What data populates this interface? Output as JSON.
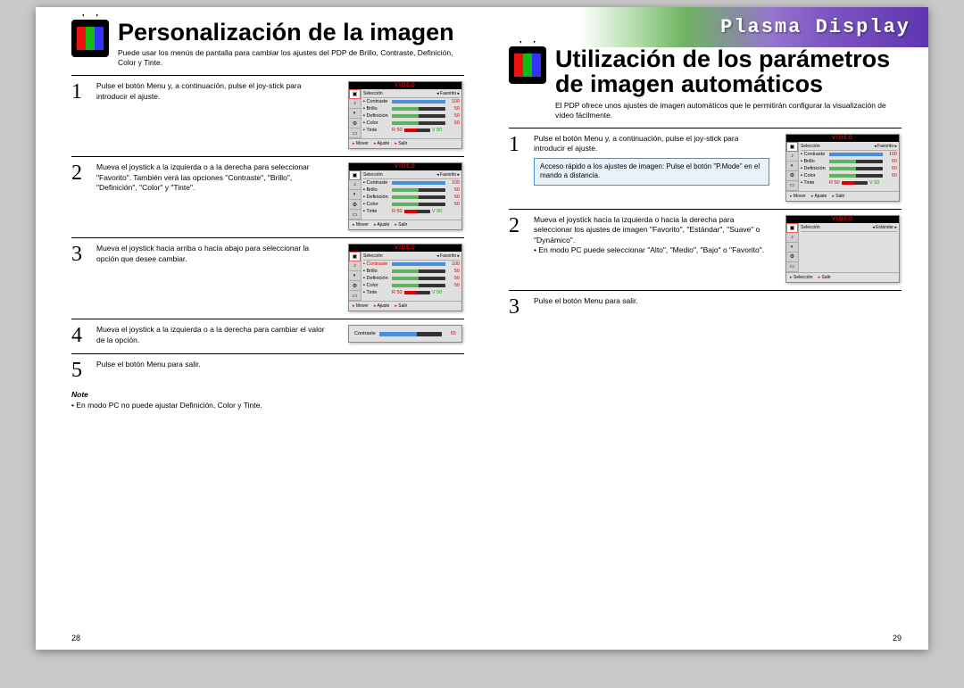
{
  "brand": "Plasma Display",
  "left": {
    "title": "Personalización de la imagen",
    "subtitle": "Puede usar los menús de pantalla para cambiar los ajustes del PDP de Brillo, Contraste, Definición, Color y Tinte.",
    "steps": [
      {
        "num": "1",
        "text": "Pulse el botón Menu y, a continuación, pulse el joy-stick para introducir el ajuste."
      },
      {
        "num": "2",
        "text": "Mueva el joystick a la izquierda o a la derecha para seleccionar \"Favorito\". También verá las opciones \"Contraste\", \"Brillo\", \"Definición\", \"Color\" y \"Tinte\"."
      },
      {
        "num": "3",
        "text": "Mueva el joystick hacia arriba o hacia abajo para seleccionar la opción que desee cambiar."
      },
      {
        "num": "4",
        "text": "Mueva el joystick a la izquierda o a la derecha para cambiar el valor de la opción."
      },
      {
        "num": "5",
        "text": "Pulse el botón Menu para salir."
      }
    ],
    "note_label": "Note",
    "note": "En modo PC no puede ajustar Definición, Color y Tinte.",
    "page_num": "28"
  },
  "right": {
    "title": "Utilización de los parámetros de imagen automáticos",
    "subtitle": "El PDP ofrece unos ajustes de imagen automáticos que le permitirán configurar la visualización de vídeo fácilmente.",
    "steps": [
      {
        "num": "1",
        "text": "Pulse el botón Menu y, a continuación, pulse el joy-stick para introducir el ajuste.",
        "info": "Acceso rápido a los ajustes de imagen: Pulse el botón \"P.Mode\" en el mando a distancia."
      },
      {
        "num": "2",
        "text": "Mueva el joystick hacia la izquierda o hacia la derecha para seleccionar los ajustes de imagen \"Favorito\", \"Estándar\", \"Suave\" o \"Dynámico\".\n• En modo PC puede seleccionar \"Alto\", \"Medio\", \"Bajo\" o \"Favorito\"."
      },
      {
        "num": "3",
        "text": "Pulse el botón Menu para salir."
      }
    ],
    "page_num": "29"
  },
  "osd": {
    "title": "VIDEO",
    "header_sel": "Selección",
    "header_fav": "Favorito",
    "header_est": "Estándar",
    "rows": [
      {
        "label": "Contraste",
        "val": "100",
        "color": "#4a90d9",
        "pct": 100
      },
      {
        "label": "Brillo",
        "val": "50",
        "color": "#5fb35f",
        "pct": 50
      },
      {
        "label": "Definición",
        "val": "50",
        "color": "#5fb35f",
        "pct": 50
      },
      {
        "label": "Color",
        "val": "50",
        "color": "#5fb35f",
        "pct": 50
      }
    ],
    "tinte": {
      "label": "Tinte",
      "r": "R 50",
      "v": "V 50"
    },
    "footer": [
      "Mover",
      "Ajuste",
      "Salir"
    ],
    "footer_alt": [
      "Selección",
      "Salir"
    ],
    "simple_label": "Contraste",
    "simple_val": "65"
  }
}
